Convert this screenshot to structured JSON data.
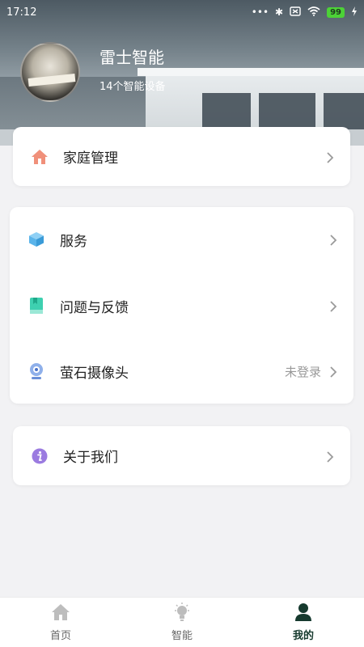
{
  "status_bar": {
    "time": "17:12",
    "dots": "•••",
    "bluetooth": "✱",
    "battery": "99"
  },
  "profile": {
    "name": "雷士智能",
    "device_count": "14个智能设备"
  },
  "cards": [
    {
      "rows": [
        {
          "label": "家庭管理",
          "icon": "home-icon",
          "color": "#f0907a",
          "hint": ""
        }
      ]
    },
    {
      "rows": [
        {
          "label": "服务",
          "icon": "box-icon",
          "color": "#5ab4ea",
          "hint": ""
        },
        {
          "label": "问题与反馈",
          "icon": "book-icon",
          "color": "#3ed0b0",
          "hint": ""
        },
        {
          "label": "萤石摄像头",
          "icon": "camera-icon",
          "color": "#6a8fd8",
          "hint": "未登录"
        }
      ]
    },
    {
      "rows": [
        {
          "label": "关于我们",
          "icon": "info-icon",
          "color": "#9b7be0",
          "hint": ""
        }
      ]
    }
  ],
  "tabbar": {
    "items": [
      {
        "label": "首页",
        "icon": "house-icon",
        "active": false
      },
      {
        "label": "智能",
        "icon": "bulb-icon",
        "active": false
      },
      {
        "label": "我的",
        "icon": "person-icon",
        "active": true
      }
    ],
    "active_color": "#163a2e",
    "inactive_color": "#bdbdbd"
  }
}
